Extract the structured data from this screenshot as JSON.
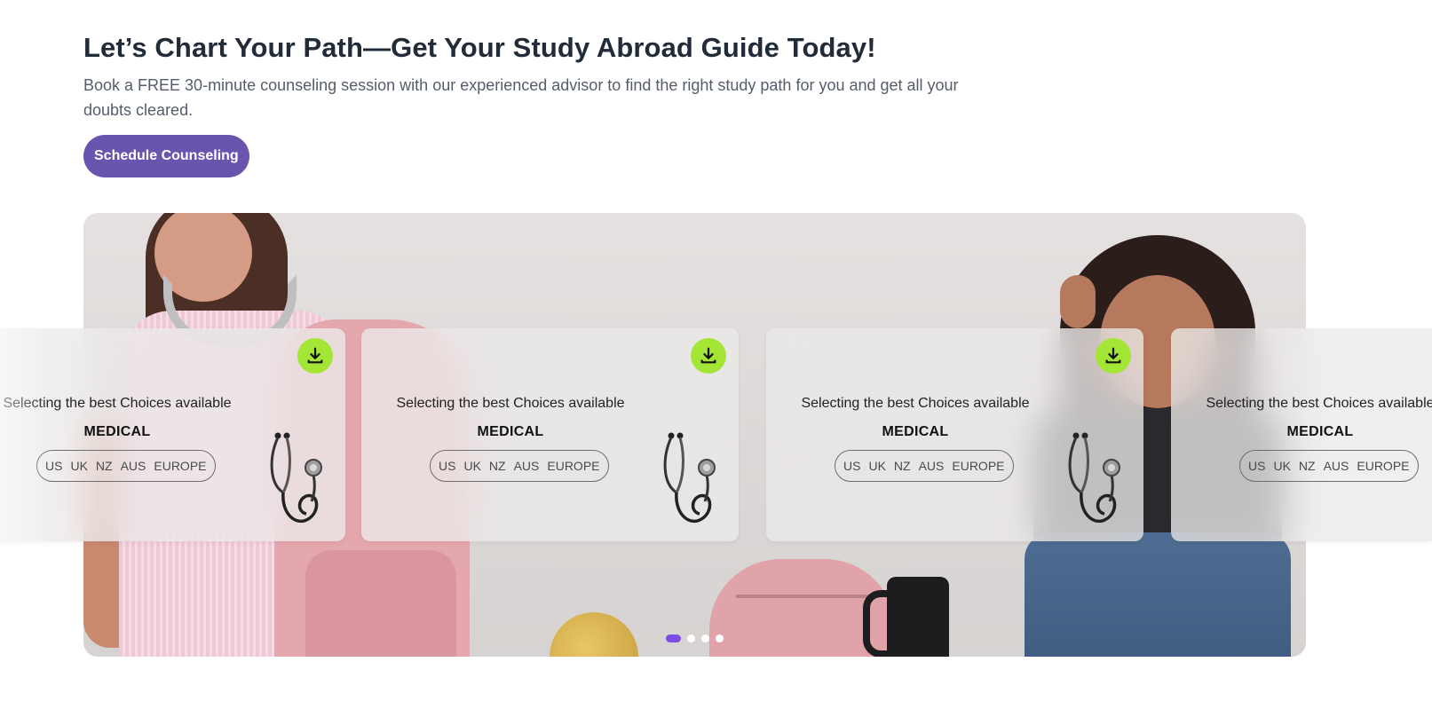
{
  "hero": {
    "title": "Let’s Chart Your Path—Get Your Study Abroad Guide Today!",
    "subtitle": "Book a FREE 30-minute counseling session with our experienced advisor to find the right study path for you and get all your doubts cleared.",
    "cta_label": "Schedule Counseling"
  },
  "colors": {
    "cta": "#6a55ae",
    "download_button": "#a3e635",
    "active_dot": "#7c4de6"
  },
  "cards": [
    {
      "tagline": "Selecting the best Choices available",
      "title": "MEDICAL",
      "regions": [
        "US",
        "UK",
        "NZ",
        "AUS",
        "EUROPE"
      ],
      "icon": "stethoscope-icon"
    },
    {
      "tagline": "Selecting the best Choices available",
      "title": "MEDICAL",
      "regions": [
        "US",
        "UK",
        "NZ",
        "AUS",
        "EUROPE"
      ],
      "icon": "stethoscope-icon"
    },
    {
      "tagline": "Selecting the best Choices available",
      "title": "MEDICAL",
      "regions": [
        "US",
        "UK",
        "NZ",
        "AUS",
        "EUROPE"
      ],
      "icon": "stethoscope-icon"
    },
    {
      "tagline": "Selecting the best Choices available",
      "title": "MEDICAL",
      "regions": [
        "US",
        "UK",
        "NZ",
        "AUS",
        "EUROPE"
      ],
      "icon": "stethoscope-icon"
    }
  ],
  "carousel": {
    "total_slides": 4,
    "active_slide": 1
  }
}
